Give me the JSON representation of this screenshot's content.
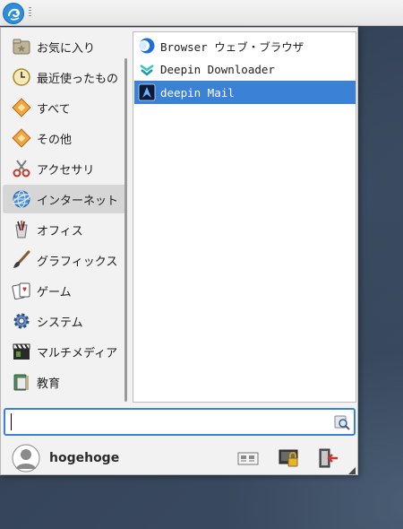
{
  "panel": {
    "launcher_icon": "deepin-launcher-icon",
    "handle_icon": "panel-grip-icon"
  },
  "categories": [
    {
      "label": "お気に入り",
      "icon": "favorites-folder-icon"
    },
    {
      "label": "最近使ったもの",
      "icon": "recent-clock-icon"
    },
    {
      "label": "すべて",
      "icon": "all-applications-icon"
    },
    {
      "label": "その他",
      "icon": "other-applications-icon"
    },
    {
      "label": "アクセサリ",
      "icon": "accessories-scissors-icon"
    },
    {
      "label": "インターネット",
      "icon": "internet-globe-icon"
    },
    {
      "label": "オフィス",
      "icon": "office-icon"
    },
    {
      "label": "グラフィックス",
      "icon": "graphics-brush-icon"
    },
    {
      "label": "ゲーム",
      "icon": "games-cards-icon"
    },
    {
      "label": "システム",
      "icon": "system-gear-icon"
    },
    {
      "label": "マルチメディア",
      "icon": "multimedia-clapper-icon"
    },
    {
      "label": "教育",
      "icon": "education-icon"
    }
  ],
  "active_category": "インターネット",
  "apps": [
    {
      "label": "Browser ウェブ・ブラウザ",
      "icon": "browser-icon"
    },
    {
      "label": "Deepin Downloader",
      "icon": "deepin-downloader-icon"
    },
    {
      "label": "deepin Mail",
      "icon": "deepin-mail-icon"
    }
  ],
  "selected_app": "deepin Mail",
  "search": {
    "value": "",
    "placeholder": "",
    "icon": "search-icon"
  },
  "footer": {
    "username": "hogehoge",
    "avatar_icon": "user-avatar-icon",
    "buttons": [
      {
        "name": "switch-user-button",
        "icon": "switch-user-icon"
      },
      {
        "name": "lock-screen-button",
        "icon": "lock-screen-icon"
      },
      {
        "name": "logout-button",
        "icon": "logout-icon"
      }
    ]
  },
  "colors": {
    "selection": "#3b82d6",
    "menu_background": "#f2f2f2",
    "active_category": "#d6d6d6"
  }
}
